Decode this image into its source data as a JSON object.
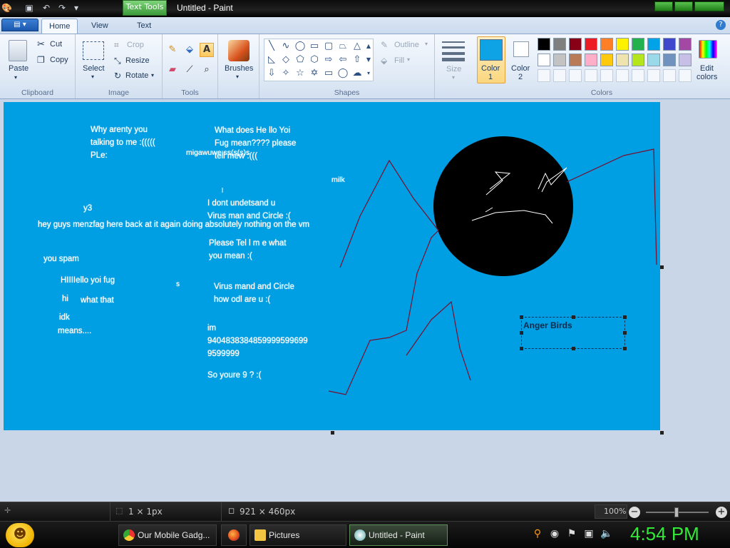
{
  "app": {
    "title": "Untitled - Paint",
    "context_tab": "Text Tools"
  },
  "tabs": [
    "Home",
    "View",
    "Text"
  ],
  "ribbon": {
    "clipboard": {
      "paste": "Paste",
      "cut": "Cut",
      "copy": "Copy",
      "label": "Clipboard"
    },
    "image": {
      "select": "Select",
      "crop": "Crop",
      "resize": "Resize",
      "rotate": "Rotate",
      "label": "Image"
    },
    "tools": {
      "label": "Tools"
    },
    "brushes": {
      "label": "Brushes"
    },
    "shapes": {
      "outline": "Outline",
      "fill": "Fill",
      "label": "Shapes"
    },
    "size": {
      "label": "Size"
    },
    "colors": {
      "color1": "Color",
      "color1_num": "1",
      "color2": "Color",
      "color2_num": "2",
      "edit": "Edit",
      "edit2": "colors",
      "label": "Colors",
      "color1_value": "#0ea3e4",
      "color2_value": "#ffffff",
      "palette_row1": [
        "#000000",
        "#7f7f7f",
        "#880015",
        "#ed1c24",
        "#ff7f27",
        "#fff200",
        "#22b14c",
        "#00a2e8",
        "#3f48cc",
        "#a349a4"
      ],
      "palette_row2": [
        "#ffffff",
        "#c3c3c3",
        "#b97a57",
        "#ffaec9",
        "#ffc90e",
        "#efe4b0",
        "#b5e61d",
        "#99d9ea",
        "#7092be",
        "#c8bfe7"
      ]
    }
  },
  "canvas": {
    "background": "#009ee2",
    "texts": [
      "Why arenty you",
      "talking to me :(((((",
      "PLe:",
      "What does He llo Yoi",
      "Fug mean???? please",
      "tell mew :(((",
      "migawuwe:ss(s(s)s",
      "milk",
      "y3",
      "I dont undetsand u",
      "Virus man and Circle :(",
      "hey guys menzfag here back at it again doing absolutely nothing on the vm",
      "Please Tel l m e what",
      "you mean :(",
      "you spam",
      "HIIIIello yoi fug",
      "hi",
      "what that",
      "s",
      "Virus mand and Circle",
      "how odl are u :(",
      "idk",
      "means....",
      "im",
      "9404838384859999599699",
      "9599999",
      "So youre 9 ? :(",
      "Anger Birds"
    ]
  },
  "status": {
    "selection_size": "1 × 1px",
    "image_size": "921 × 460px",
    "zoom": "100%"
  },
  "taskbar": {
    "items": [
      "Our Mobile Gadg...",
      "Pictures",
      "Untitled - Paint"
    ],
    "clock": "4:54 PM"
  }
}
